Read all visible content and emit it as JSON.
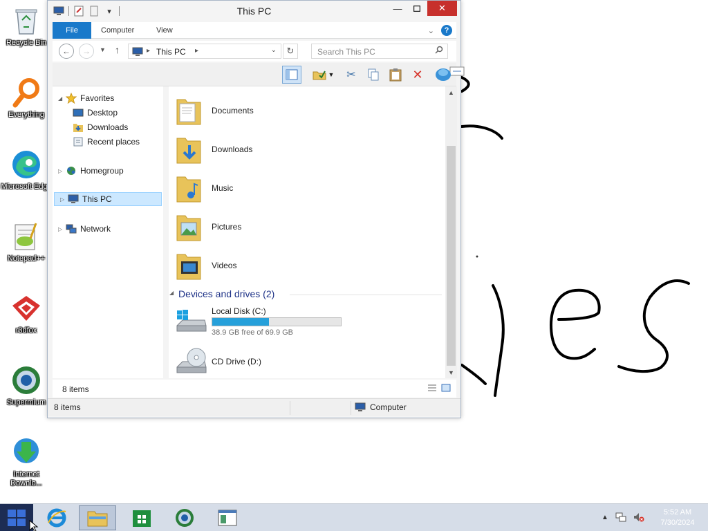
{
  "desktop": {
    "icons": [
      {
        "label": "Recycle Bin",
        "icon": "recycle-bin-icon"
      },
      {
        "label": "Everything",
        "icon": "everything-icon"
      },
      {
        "label": "Microsoft Edge",
        "icon": "edge-icon"
      },
      {
        "label": "Notepad++",
        "icon": "notepadpp-icon"
      },
      {
        "label": "r3dfox",
        "icon": "r3dfox-icon"
      },
      {
        "label": "Supermium",
        "icon": "supermium-icon"
      },
      {
        "label": "Internet Downlo...",
        "icon": "idm-icon"
      }
    ]
  },
  "window": {
    "title": "This PC",
    "ribbon_tabs": [
      "File",
      "Computer",
      "View"
    ],
    "address": {
      "location": "This PC"
    },
    "search": {
      "placeholder": "Search This PC"
    },
    "nav": {
      "favorites": "Favorites",
      "favorites_items": [
        "Desktop",
        "Downloads",
        "Recent places"
      ],
      "homegroup": "Homegroup",
      "this_pc": "This PC",
      "network": "Network"
    },
    "folders": [
      "Documents",
      "Downloads",
      "Music",
      "Pictures",
      "Videos"
    ],
    "devices_group": "Devices and drives (2)",
    "drives": [
      {
        "name": "Local Disk (C:)",
        "free_text": "38.9 GB free of 69.9 GB",
        "used_fraction": 0.44
      },
      {
        "name": "CD Drive (D:)"
      }
    ],
    "pane_item_count": "8 items",
    "status_item_count": "8 items",
    "status_location": "Computer"
  },
  "taskbar": {
    "clock_time": "5:52 AM",
    "clock_date": "7/30/2024"
  },
  "colors": {
    "accent": "#1979ca",
    "close_button": "#c7302c",
    "drive_bar": "#26a0da",
    "group_title": "#1e3287"
  }
}
